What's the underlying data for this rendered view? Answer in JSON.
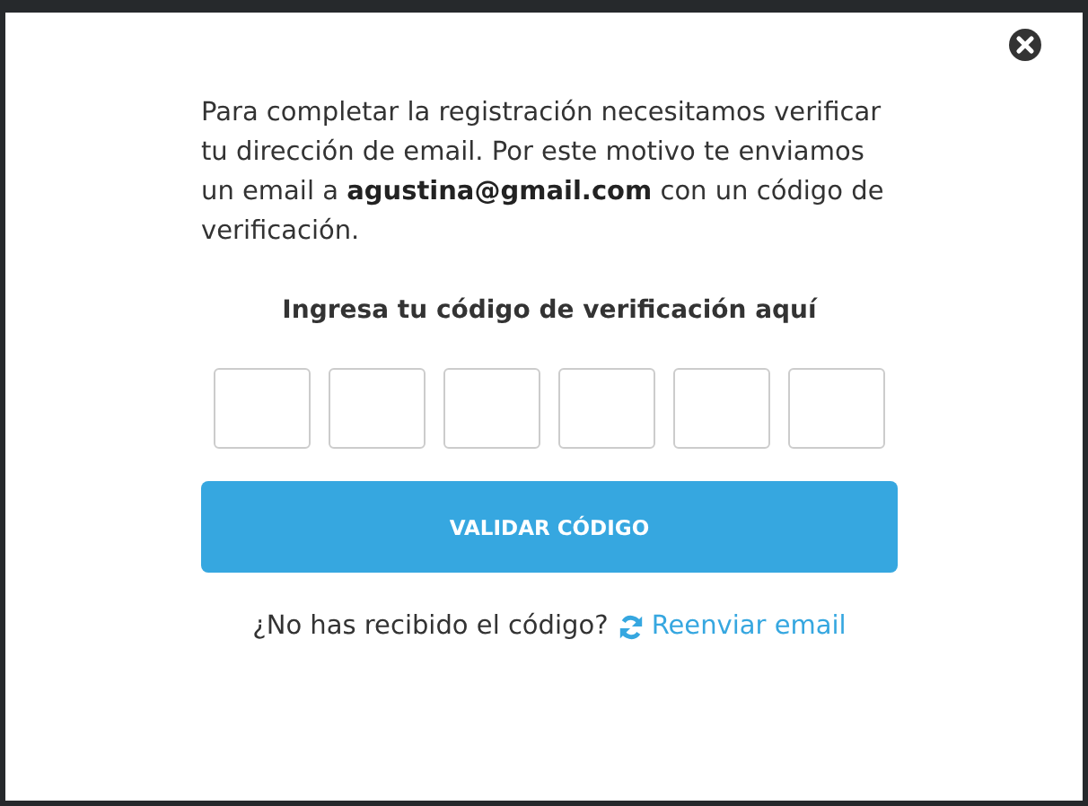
{
  "dialog": {
    "message": "Para completar la registración necesitamos verificar tu dirección de email. Por este motivo te enviamos un email a **agustina@gmail.com** con un código de verificación.",
    "code_label": "Ingresa tu código de verificación aquí",
    "code_boxes": [
      {
        "kind": "digit"
      },
      {
        "kind": "digit"
      },
      {
        "kind": "digit"
      },
      {
        "kind": "digit"
      },
      {
        "kind": "digit"
      },
      {
        "kind": "digit"
      }
    ],
    "submit_button": "VALIDAR CÓDIGO",
    "resend_prompt": "¿No has recibido el código?",
    "resend_link": "Reenviar email"
  }
}
